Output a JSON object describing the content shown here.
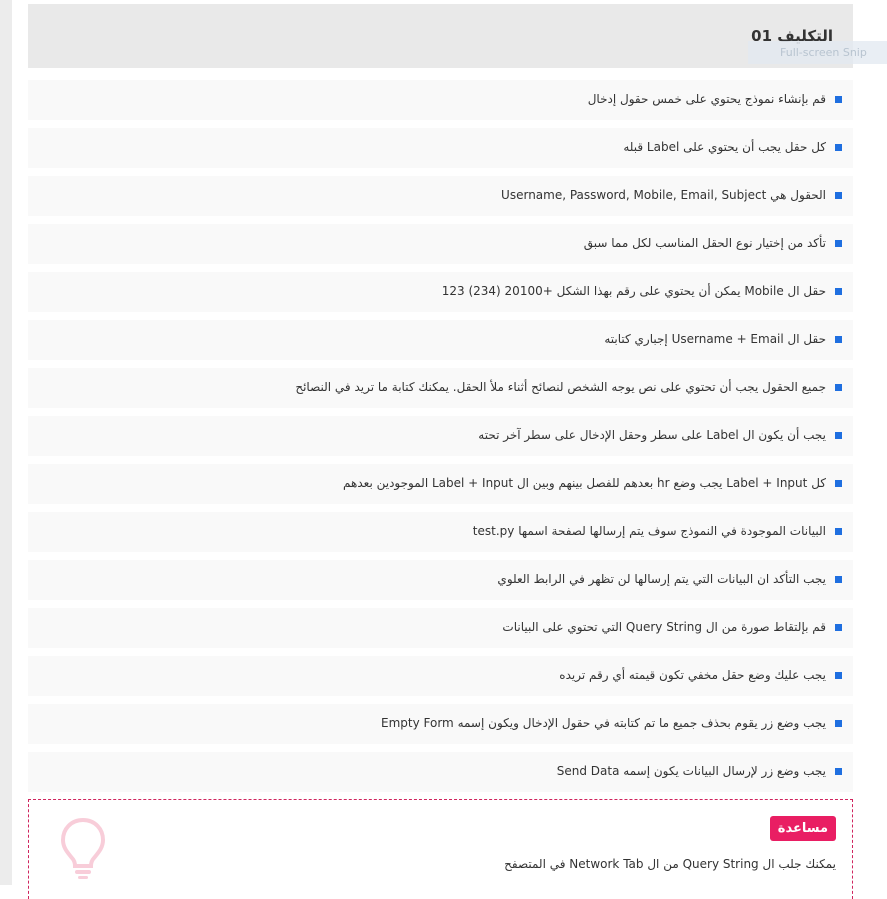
{
  "header": {
    "title": "التكليف 01"
  },
  "overlay": {
    "snip_label": "Full-screen Snip"
  },
  "items": [
    {
      "text": "قم بإنشاء نموذج يحتوي على خمس حقول إدخال"
    },
    {
      "text": "كل حقل يجب أن يحتوي على Label قبله"
    },
    {
      "text": "الحقول هي Username, Password, Mobile, Email, Subject"
    },
    {
      "text": "تأكد من إختيار نوع الحقل المناسب لكل مما سبق"
    },
    {
      "text": "حقل ال Mobile يمكن أن يحتوي على رقم بهذا الشكل +20100 (234) 123"
    },
    {
      "text": "حقل ال Username + Email إجباري كتابته"
    },
    {
      "text": "جميع الحقول يجب أن تحتوي على نص يوجه الشخص لنصائح أثناء ملأ الحقل. يمكنك كتابة ما تريد في النصائح"
    },
    {
      "text": "يجب أن يكون ال Label على سطر وحقل الإدخال على سطر آخر تحته"
    },
    {
      "text": "كل Label + Input يجب وضع hr بعدهم للفصل بينهم وبين ال Label + Input الموجودين بعدهم"
    },
    {
      "text": "البيانات الموجودة في النموذج سوف يتم إرسالها لصفحة اسمها test.py"
    },
    {
      "text": "يجب التأكد ان البيانات التي يتم إرسالها لن تظهر في الرابط العلوي"
    },
    {
      "text": "قم بإلتقاط صورة من ال Query String التي تحتوي على البيانات"
    },
    {
      "text": "يجب عليك وضع حقل مخفي تكون قيمته أي رقم تريده"
    },
    {
      "text": "يجب وضع زر يقوم بحذف جميع ما تم كتابته في حقول الإدخال ويكون إسمه Empty Form"
    },
    {
      "text": "يجب وضع زر لإرسال البيانات يكون إسمه Send Data"
    }
  ],
  "help": {
    "badge": "مساعدة",
    "text": "يمكنك جلب ال Query String من ال Network Tab في المتصفح",
    "icon": "lightbulb-icon"
  },
  "colors": {
    "bullet": "#1f6fe0",
    "accent": "#e91e63",
    "header_bg": "#e9e9e9",
    "item_bg": "#f9f9f9"
  }
}
